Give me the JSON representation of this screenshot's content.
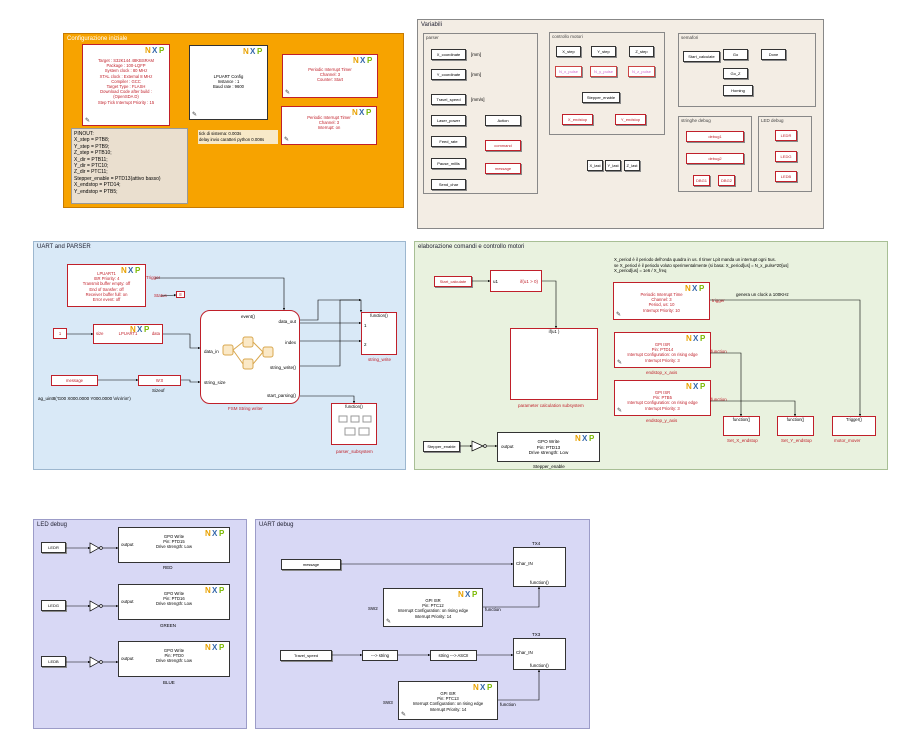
{
  "areas": {
    "config_title": "Configurazione iniziale",
    "variabili_title": "Variabili",
    "uart_parser_title": "UART and PARSER",
    "elab_title": "elaborazione comandi e controllo motori",
    "led_debug_title": "LED debug",
    "uart_debug_title": "UART debug"
  },
  "config": {
    "target_lines": [
      "Target : S32K144 48KBSRAM",
      "Package : 100-LQFP",
      "System clock : 80 MHz",
      "XTAL clock : External 8 MHz",
      "Compiler : GCC",
      "Target Type : FLASH",
      "Download Code after build :",
      "(OpenSDA D)",
      "Step Tick Interrupt Priority : 15"
    ],
    "lpuart_lines": [
      "LPUART Config",
      "Instance : 1",
      "Baud rate : 9600"
    ],
    "pit1_lines": [
      "Periodic Interrupt Timer",
      "Channel: 3",
      "Counter: Start"
    ],
    "pit2_lines": [
      "Periodic Interrupt Timer",
      "Channel: 3",
      "Interrupt: on"
    ],
    "pinout_lines": [
      "PINOUT:",
      "X_step = PTB8;",
      "Y_step = PTB9;",
      "Z_step = PTB10;",
      "X_dir = PTB11;",
      "Y_dir = PTC10;",
      "Z_dir = PTC11;",
      "Stepper_enable = PTD13(attivo basso)",
      "X_endstop = PTD14;",
      "Y_endstop = PTB5;"
    ],
    "tick_lines": [
      "tick di sistema: 0.003s",
      "delay invio caratteri python 0.008s"
    ]
  },
  "variabili": {
    "parser_title": "parser",
    "parser_left": [
      "X_coordinate",
      "Y_coordinate",
      "Travel_speed",
      "Laser_power",
      "Feed_rate",
      "Pause_millis",
      "Send_char"
    ],
    "parser_units": [
      "[mm]",
      "[mm]",
      "[mm/s]"
    ],
    "parser_right": [
      "Action",
      "command",
      "message"
    ],
    "controllo_title": "controllo motori",
    "steps": [
      "X_step",
      "Y_step",
      "Z_step"
    ],
    "pulses": [
      "N_x_pulse",
      "N_y_pulse",
      "N_z_pulse"
    ],
    "stepper_enable": "Stepper_enable",
    "endstops": [
      "X_endstop",
      "Y_endstop"
    ],
    "lasts": [
      "X_last",
      "Y_last",
      "Z_last"
    ],
    "semafori_title": "semafori",
    "semafori": [
      "Start_calculate",
      "Go",
      "Done",
      "Go_Z",
      "Homing"
    ],
    "stringhe_title": "stringhe debug",
    "stringhe": [
      "debug1",
      "debug2",
      "DBG1",
      "DBG2"
    ],
    "led_title": "LED debug",
    "leds": [
      "LEDR",
      "LEDG",
      "LEDB"
    ]
  },
  "uart_parser": {
    "lpuart1_lines": [
      "LPUART1",
      "ISR Priority: 4",
      "Transmit buffer empty: off",
      "End of transfer: off",
      "Receiver buffer full: on",
      "Error event: off"
    ],
    "trigger": "Trigger",
    "status": "Status",
    "const_one": "1",
    "size_label": "size",
    "lpuart_label": "LPUART1",
    "data_label": "data",
    "message": "message",
    "w0": "W:0",
    "sizeof": "Sizeof",
    "uint8_text": "ag_uint8('G00 X000.0000 Y000.0000 \\n\\n\\n\\n')",
    "fsm_title": "FSM String writer",
    "fsm_ports_in": [
      "data_in",
      "string_size"
    ],
    "fsm_ports_out": [
      "event()",
      "data_out",
      "index",
      "string_write()",
      "start_parsing()"
    ],
    "string_write": "string_write",
    "function_label": "function()",
    "parser_subsystem": "parser_subsystem",
    "port_1": "1",
    "port_2": "2"
  },
  "elab": {
    "start_calculate": "Start_calculate",
    "u1": "u1",
    "ifu1": "if(u1 > 0)",
    "if_action": "if(u1 )",
    "param_subsystem": "parameter calculation subsystem",
    "note_lines": [
      "X_period è il periodo dell'onda quadra in us. Il timer Lpit manda un interrupt ogni 5us.",
      "se X_period è il periodo voluto sperimentalmente (si basa:  X_period[us] = N_x_pulse*20[us]",
      "X_period[us] = 1e6 / X_freq"
    ],
    "pit_lines": [
      "Periodic Interrupt Time",
      "Channel: 3",
      "Period, us: 10",
      "Interrupt Priority: 10"
    ],
    "trigger": "trigger",
    "genera": "genera un clock a 100KHz",
    "gpi1_lines": [
      "GPI ISR",
      "Pin: PTD14",
      "Interrupt Configuration: on rising edge",
      "Interrupt Priority: 3"
    ],
    "gpi1_name": "endstop_x_axis",
    "gpi2_lines": [
      "GPI ISR",
      "Pin: PTB5",
      "Interrupt Configuration: on rising edge",
      "Interrupt Priority: 3"
    ],
    "gpi2_name": "endstop_y_axis",
    "function": "function",
    "fn_call": "function()",
    "set_x": "Set_X_endstop",
    "set_y": "Set_Y_endstop",
    "motor_mover": "motor_mover",
    "trigger2": "Trigger()",
    "stepper_enable": "Stepper_enable",
    "output": "output",
    "gpo_lines": [
      "GPO Write",
      "Pin: PTD13",
      "Drive strength: Low"
    ],
    "gpo_name": "Stepper_enable"
  },
  "led_debug": {
    "rows": [
      {
        "in": "LEDR",
        "pin": "Pin: PTD15",
        "name": "RED"
      },
      {
        "in": "LEDG",
        "pin": "Pin: PTD16",
        "name": "GREEN"
      },
      {
        "in": "LEDB",
        "pin": "Pin: PTD0",
        "name": "BLUE"
      }
    ],
    "gpo": "GPO Write",
    "drive": "Drive strength: Low",
    "output": "output"
  },
  "uart_debug": {
    "message": "message",
    "tx4": "TX4",
    "tx3": "TX3",
    "char_in": "Char_IN",
    "function_call": "function()",
    "sw2": "SW2",
    "sw3": "SW3",
    "gpi_isr": "GPI ISR",
    "pin_c12": "Pin: PTC12",
    "pin_c13": "Pin: PTC13",
    "int_conf": "Interrupt Configuration: on rising edge",
    "int_prio": "Interrupt Priority: 14",
    "function": "function",
    "travel_speed": "Travel_speed",
    "to_string": "---> string",
    "string_ascii": "string ---> ASCII"
  },
  "colors": {
    "orange": "#f7a300",
    "beige": "#f3ede4",
    "blue_area": "#d9e9f7",
    "green_area": "#e9f2df",
    "purple_area": "#d8d8f5",
    "nxp_n": "#e8a100",
    "nxp_x": "#3366aa",
    "nxp_p": "#7ab800",
    "red": "#c0202a"
  }
}
